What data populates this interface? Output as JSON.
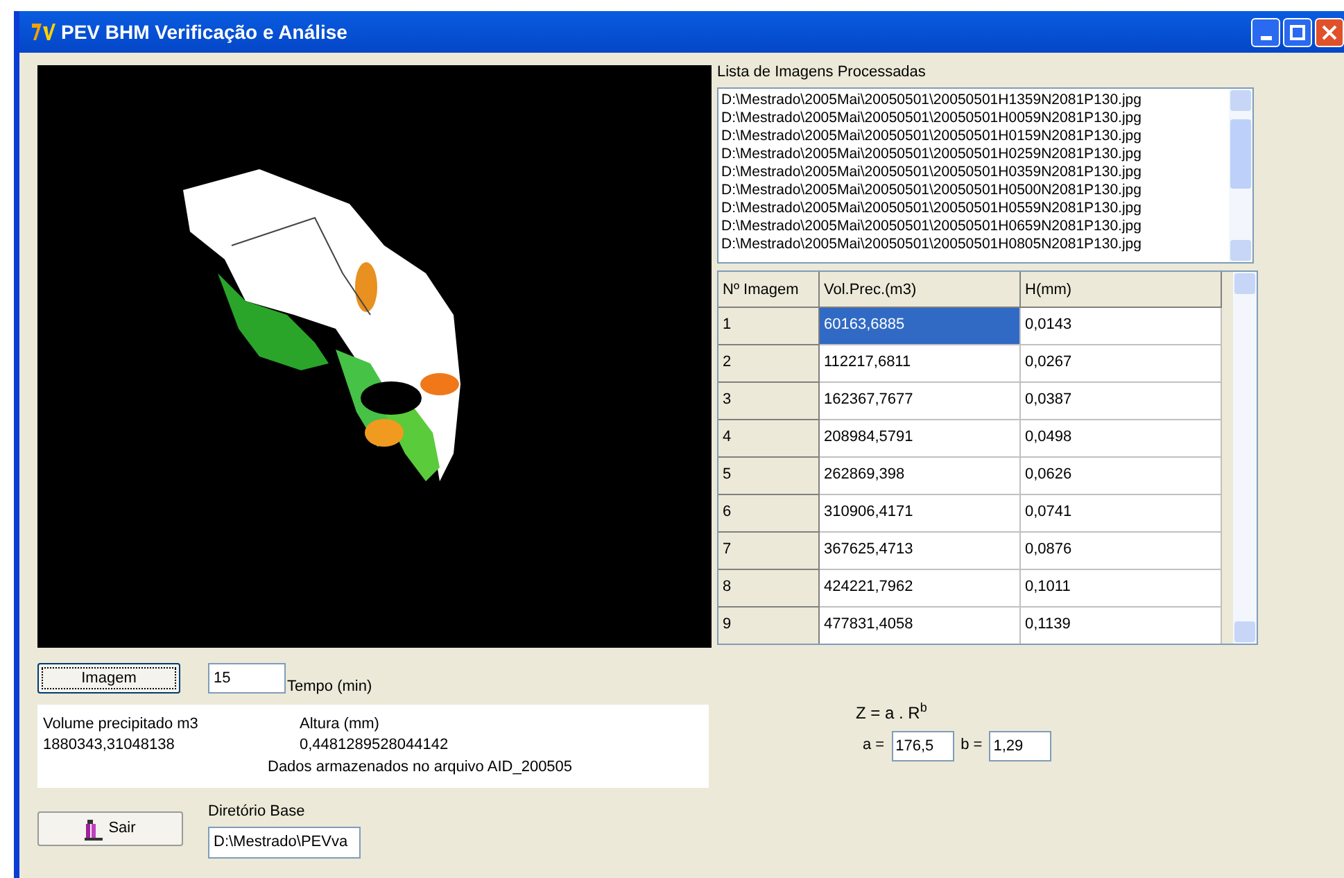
{
  "window": {
    "title": "PEV BHM Verificação e Análise"
  },
  "processed_list": {
    "label": "Lista de Imagens Processadas",
    "items": [
      "D:\\Mestrado\\2005Mai\\20050501\\20050501H1359N2081P130.jpg",
      "D:\\Mestrado\\2005Mai\\20050501\\20050501H0059N2081P130.jpg",
      "D:\\Mestrado\\2005Mai\\20050501\\20050501H0159N2081P130.jpg",
      "D:\\Mestrado\\2005Mai\\20050501\\20050501H0259N2081P130.jpg",
      "D:\\Mestrado\\2005Mai\\20050501\\20050501H0359N2081P130.jpg",
      "D:\\Mestrado\\2005Mai\\20050501\\20050501H0500N2081P130.jpg",
      "D:\\Mestrado\\2005Mai\\20050501\\20050501H0559N2081P130.jpg",
      "D:\\Mestrado\\2005Mai\\20050501\\20050501H0659N2081P130.jpg",
      "D:\\Mestrado\\2005Mai\\20050501\\20050501H0805N2081P130.jpg"
    ]
  },
  "table": {
    "columns": [
      "Nº Imagem",
      "Vol.Prec.(m3)",
      "H(mm)"
    ],
    "rows": [
      {
        "cells": [
          "1",
          "60163,6885",
          "0,0143"
        ],
        "selected": true
      },
      {
        "cells": [
          "2",
          "112217,6811",
          "0,0267"
        ],
        "selected": false
      },
      {
        "cells": [
          "3",
          "162367,7677",
          "0,0387"
        ],
        "selected": false
      },
      {
        "cells": [
          "4",
          "208984,5791",
          "0,0498"
        ],
        "selected": false
      },
      {
        "cells": [
          "5",
          "262869,398",
          "0,0626"
        ],
        "selected": false
      },
      {
        "cells": [
          "6",
          "310906,4171",
          "0,0741"
        ],
        "selected": false
      },
      {
        "cells": [
          "7",
          "367625,4713",
          "0,0876"
        ],
        "selected": false
      },
      {
        "cells": [
          "8",
          "424221,7962",
          "0,1011"
        ],
        "selected": false
      },
      {
        "cells": [
          "9",
          "477831,4058",
          "0,1139"
        ],
        "selected": false
      }
    ]
  },
  "image_button": "Imagem",
  "time_field": {
    "value": "15",
    "label": "Tempo (min)"
  },
  "results": {
    "volume_label": "Volume precipitado m3",
    "volume_value": "1880343,31048138",
    "height_label": "Altura (mm)",
    "height_value": "0,4481289528044142",
    "file_note": "Dados armazenados no arquivo AID_200505"
  },
  "exit_button": "Sair",
  "base_dir": {
    "label": "Diretório Base",
    "value": "D:\\Mestrado\\PEVva"
  },
  "formula": {
    "text": "Z = a . R$^{b}$",
    "a_label": "a =",
    "a_value": "176,5",
    "b_label": "b =",
    "b_value": "1,29"
  }
}
